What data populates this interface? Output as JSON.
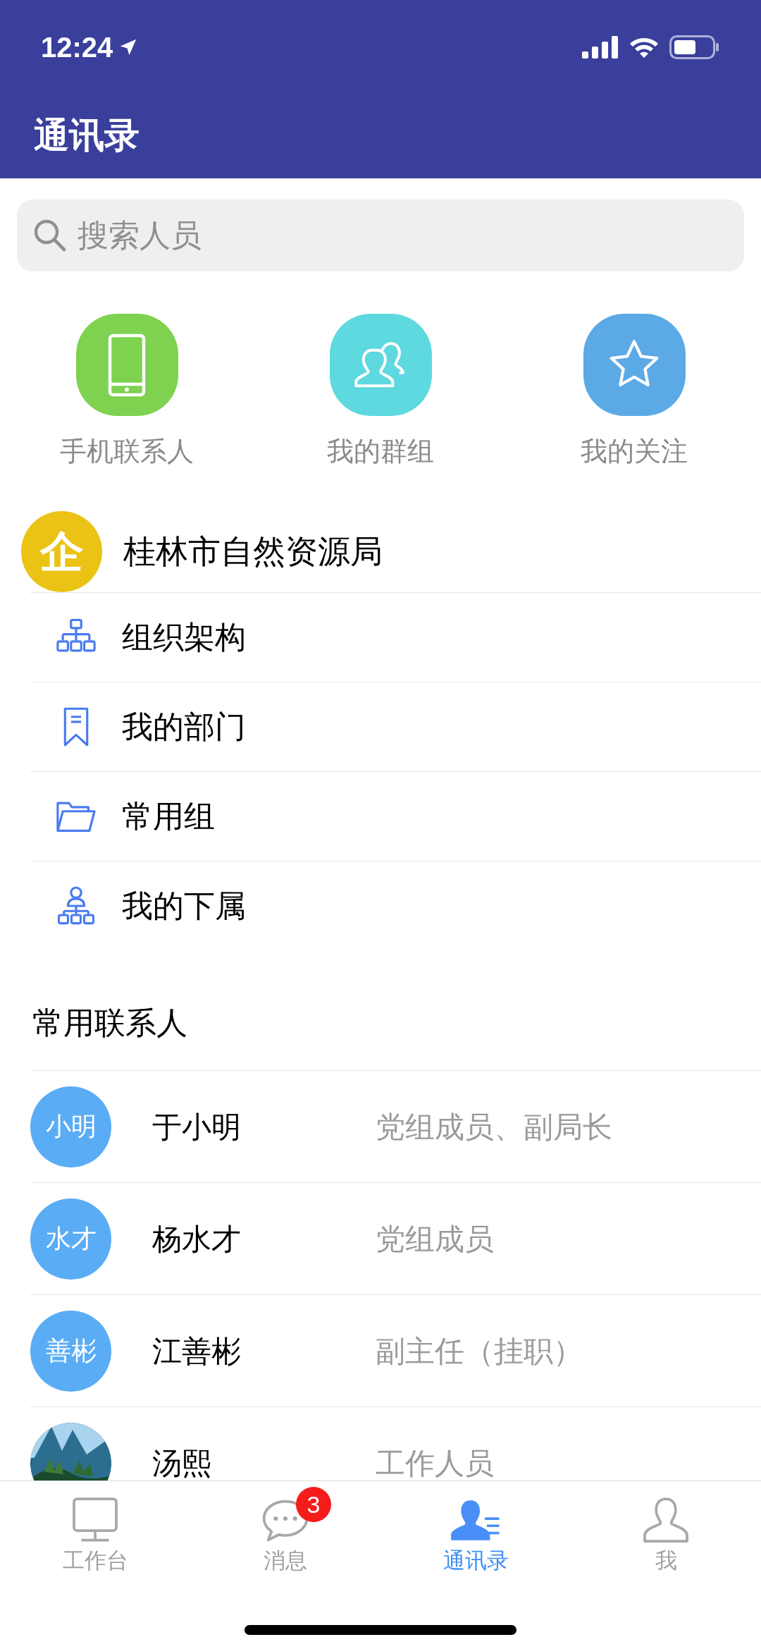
{
  "status_bar": {
    "time": "12:24"
  },
  "header": {
    "title": "通讯录"
  },
  "search": {
    "placeholder": "搜索人员"
  },
  "quick_actions": [
    {
      "label": "手机联系人",
      "color": "#7ed24f"
    },
    {
      "label": "我的群组",
      "color": "#5dd9df"
    },
    {
      "label": "我的关注",
      "color": "#5baae6"
    }
  ],
  "organization": {
    "badge": "企",
    "name": "桂林市自然资源局",
    "items": [
      {
        "label": "组织架构"
      },
      {
        "label": "我的部门"
      },
      {
        "label": "常用组"
      },
      {
        "label": "我的下属"
      }
    ]
  },
  "frequent_contacts": {
    "title": "常用联系人",
    "contacts": [
      {
        "avatar": {
          "kind": "initials",
          "text": "小明"
        },
        "name": "于小明",
        "position": "党组成员、副局长"
      },
      {
        "avatar": {
          "kind": "initials",
          "text": "水才"
        },
        "name": "杨水才",
        "position": "党组成员"
      },
      {
        "avatar": {
          "kind": "initials",
          "text": "善彬"
        },
        "name": "江善彬",
        "position": "副主任（挂职）"
      },
      {
        "name": "汤熙",
        "position": "工作人员"
      }
    ]
  },
  "tab_bar": [
    {
      "label": "工作台",
      "selected": false
    },
    {
      "label": "消息",
      "selected": false,
      "badge": "3"
    },
    {
      "label": "通讯录",
      "selected": true
    },
    {
      "label": "我",
      "selected": false
    }
  ]
}
